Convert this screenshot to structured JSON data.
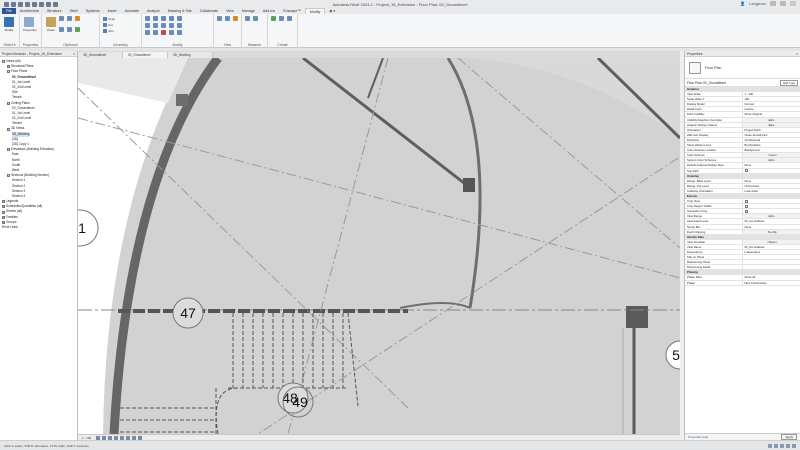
{
  "title": {
    "text": "Autodesk Revit 2024.2 - Project_15_Extension - Floor Plan: 00_Groundlevel"
  },
  "user": {
    "name": "Langeuer"
  },
  "ribbon": {
    "tabs": [
      "File",
      "Architecture",
      "Structure",
      "Steel",
      "Systems",
      "Insert",
      "Annotate",
      "Analyze",
      "Massing & Site",
      "Collaborate",
      "View",
      "Manage",
      "Add-Ins",
      "Enscape™",
      "Modify",
      "◉ ▾"
    ],
    "active_tab": "Modify",
    "panels": {
      "select": "Select ▾",
      "properties": "Properties",
      "clipboard": "Clipboard",
      "geometry": "Geometry",
      "modify": "Modify",
      "view": "View",
      "measure": "Measure",
      "create": "Create"
    },
    "tools": {
      "modify": "Modify",
      "properties": "Properties",
      "paste": "Paste",
      "cope": "Cope",
      "cut": "Cut",
      "join": "Join"
    }
  },
  "browser": {
    "header": "Project Browser - Project_15_Extension",
    "items": [
      {
        "label": "Views (all)",
        "level": 0,
        "toggle": "−"
      },
      {
        "label": "Structural Plans",
        "level": 1,
        "toggle": "+"
      },
      {
        "label": "Floor Plans",
        "level": 1,
        "toggle": "−"
      },
      {
        "label": "00_Groundlevel",
        "level": 2,
        "toggle": "",
        "bold": true
      },
      {
        "label": "01_1st Level",
        "level": 2,
        "toggle": ""
      },
      {
        "label": "02_2nd Level",
        "level": 2,
        "toggle": ""
      },
      {
        "label": "Site",
        "level": 2,
        "toggle": ""
      },
      {
        "label": "Terrain",
        "level": 2,
        "toggle": ""
      },
      {
        "label": "Ceiling Plans",
        "level": 1,
        "toggle": "−"
      },
      {
        "label": "00_Groundlevel",
        "level": 2,
        "toggle": ""
      },
      {
        "label": "01_1st Level",
        "level": 2,
        "toggle": ""
      },
      {
        "label": "02_2nd Level",
        "level": 2,
        "toggle": ""
      },
      {
        "label": "Terrain",
        "level": 2,
        "toggle": ""
      },
      {
        "label": "3D Views",
        "level": 1,
        "toggle": "−"
      },
      {
        "label": "3D_Working",
        "level": 2,
        "toggle": "",
        "selected": true
      },
      {
        "label": "{3D}",
        "level": 2,
        "toggle": ""
      },
      {
        "label": "{3D} Copy 1",
        "level": 2,
        "toggle": ""
      },
      {
        "label": "Elevations (Building Elevation)",
        "level": 1,
        "toggle": "−"
      },
      {
        "label": "East",
        "level": 2,
        "toggle": ""
      },
      {
        "label": "North",
        "level": 2,
        "toggle": ""
      },
      {
        "label": "South",
        "level": 2,
        "toggle": ""
      },
      {
        "label": "West",
        "level": 2,
        "toggle": ""
      },
      {
        "label": "Sections (Building Section)",
        "level": 1,
        "toggle": "−"
      },
      {
        "label": "Section 1",
        "level": 2,
        "toggle": ""
      },
      {
        "label": "Section 2",
        "level": 2,
        "toggle": ""
      },
      {
        "label": "Section 3",
        "level": 2,
        "toggle": ""
      },
      {
        "label": "Section 4",
        "level": 2,
        "toggle": ""
      },
      {
        "label": "Legends",
        "level": 0,
        "toggle": "+"
      },
      {
        "label": "Schedules/Quantities (all)",
        "level": 0,
        "toggle": "+"
      },
      {
        "label": "Sheets (all)",
        "level": 0,
        "toggle": "+"
      },
      {
        "label": "Families",
        "level": 0,
        "toggle": "+"
      },
      {
        "label": "Groups",
        "level": 0,
        "toggle": "+"
      },
      {
        "label": "Revit Links",
        "level": 0,
        "toggle": ""
      }
    ]
  },
  "view_tabs": [
    "3D_Groundlevel",
    "00_Groundlevel",
    "3D_Working"
  ],
  "active_view_tab": 1,
  "canvas": {
    "bubbles": [
      "47",
      "48",
      "49",
      "1",
      "5"
    ]
  },
  "view_control": {
    "scale": "1 : 100"
  },
  "status": {
    "left": "Click to select, TAB for alternates, CTRL adds, SHIFT unselects."
  },
  "properties": {
    "header": "Properties",
    "type_name": "Floor Plan",
    "instance_label": "Floor Plan: 00_Groundlevel",
    "edit_type": "Edit Type",
    "rows": [
      {
        "k": "Graphics",
        "grp": true
      },
      {
        "k": "View Scale",
        "v": "1 : 100"
      },
      {
        "k": "Scale Value 1:",
        "v": "100"
      },
      {
        "k": "Display Model",
        "v": "Normal"
      },
      {
        "k": "Detail Level",
        "v": "Coarse"
      },
      {
        "k": "Parts Visibility",
        "v": "Show Original"
      },
      {
        "k": "Visibility/Graphics Overrides",
        "v": "Edit...",
        "btn": true
      },
      {
        "k": "Graphic Display Options",
        "v": "Edit...",
        "btn": true
      },
      {
        "k": "Orientation",
        "v": "Project North"
      },
      {
        "k": "Wall Join Display",
        "v": "Clean all wall joins"
      },
      {
        "k": "Discipline",
        "v": "Architectural"
      },
      {
        "k": "Show Hidden Lines",
        "v": "By Discipline"
      },
      {
        "k": "Color Scheme Location",
        "v": "Background"
      },
      {
        "k": "Color Scheme",
        "v": "<none>",
        "btn": true
      },
      {
        "k": "System Color Schemes",
        "v": "Edit...",
        "btn": true
      },
      {
        "k": "Default Analysis Display Style",
        "v": "None"
      },
      {
        "k": "Sun Path",
        "v": "",
        "cb": false
      },
      {
        "k": "Underlay",
        "grp": true
      },
      {
        "k": "Range: Base Level",
        "v": "None"
      },
      {
        "k": "Range: Top Level",
        "v": "Unbounded"
      },
      {
        "k": "Underlay Orientation",
        "v": "Look down"
      },
      {
        "k": "Extents",
        "grp": true
      },
      {
        "k": "Crop View",
        "v": "",
        "cb": false
      },
      {
        "k": "Crop Region Visible",
        "v": "",
        "cb": false
      },
      {
        "k": "Annotation Crop",
        "v": "",
        "cb": false
      },
      {
        "k": "View Range",
        "v": "Edit...",
        "btn": true
      },
      {
        "k": "Associated Level",
        "v": "00_Groundlevel"
      },
      {
        "k": "Scope Box",
        "v": "None"
      },
      {
        "k": "Depth Clipping",
        "v": "No clip",
        "btn": true
      },
      {
        "k": "Identity Data",
        "grp": true
      },
      {
        "k": "View Template",
        "v": "<None>",
        "btn": true
      },
      {
        "k": "View Name",
        "v": "00_Groundlevel"
      },
      {
        "k": "Dependency",
        "v": "Independent"
      },
      {
        "k": "Title on Sheet",
        "v": ""
      },
      {
        "k": "Referencing Sheet",
        "v": ""
      },
      {
        "k": "Referencing Detail",
        "v": ""
      },
      {
        "k": "Phasing",
        "grp": true
      },
      {
        "k": "Phase Filter",
        "v": "Show All"
      },
      {
        "k": "Phase",
        "v": "New Construction"
      }
    ],
    "help_link": "Properties help",
    "apply": "Apply"
  }
}
